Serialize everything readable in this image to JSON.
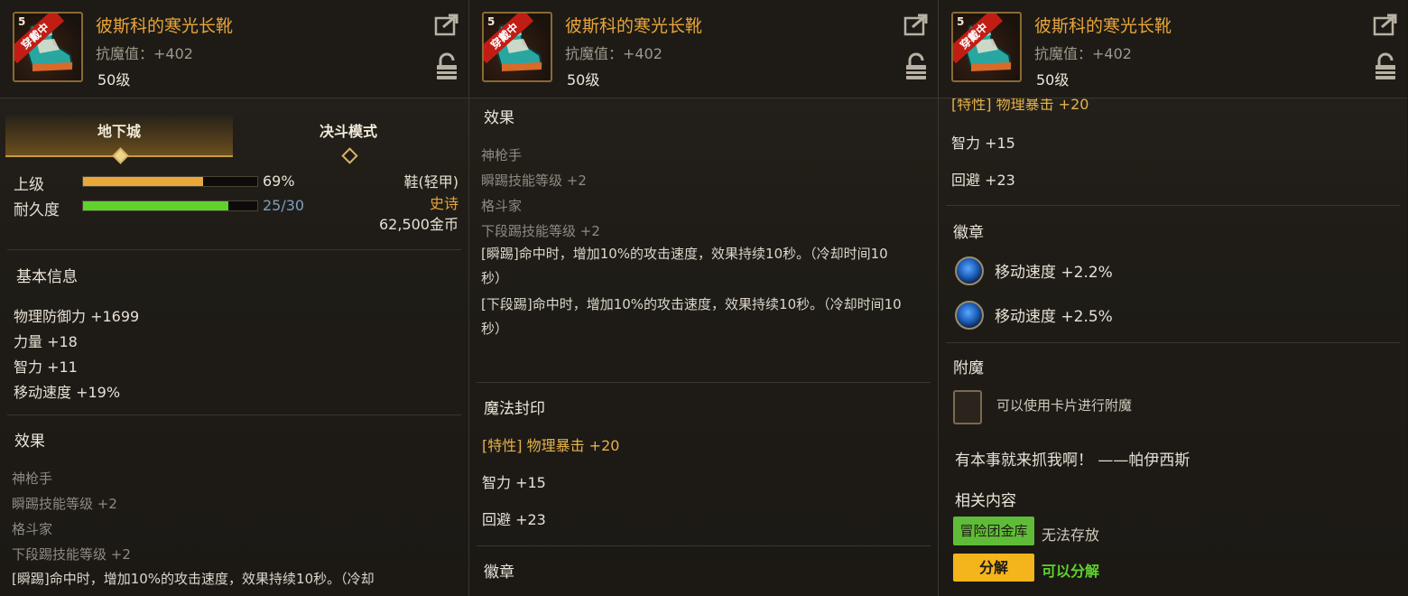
{
  "item": {
    "name": "彼斯科的寒光长靴",
    "resist": "抗魔值：+402",
    "level": "50级",
    "level_tag": "5",
    "equipped_banner": "穿戴中",
    "icon": "boot-icon"
  },
  "tabs": [
    {
      "label": "地下城",
      "active": true
    },
    {
      "label": "决斗模式",
      "active": false
    }
  ],
  "upgrade": {
    "label": "上级",
    "percent": "69%",
    "fraction": 0.69,
    "color": "#e9a93a"
  },
  "durability": {
    "label": "耐久度",
    "value": "25/30",
    "fraction": 0.8333,
    "color": "#5fd22c"
  },
  "item_type": {
    "slot": "鞋(轻甲)",
    "rarity": "史诗",
    "price": "62,500金币",
    "rarity_color": "#e7a43a"
  },
  "basic_info": {
    "title": "基本信息",
    "stats": [
      "物理防御力 +1699",
      "力量 +18",
      "智力 +11",
      "移动速度 +19%"
    ]
  },
  "effects": {
    "title": "效果",
    "lines": [
      "神枪手",
      "瞬踢技能等级 +2",
      "格斗家",
      "下段踢技能等级 +2"
    ],
    "desc1": "[瞬踢]命中时，增加10%的攻击速度，效果持续10秒。（冷却时间10秒）",
    "desc2": "[下段踢]命中时，增加10%的攻击速度，效果持续10秒。（冷却时间10秒）",
    "desc1_cut": "[瞬踢]命中时，增加10%的攻击速度，效果持续10秒。（冷却"
  },
  "magic_seal": {
    "title": "魔法封印",
    "trait": "[特性] 物理暴击 +20",
    "stats": [
      "智力 +15",
      "回避 +23"
    ]
  },
  "emblem": {
    "title": "徽章",
    "items": [
      "移动速度 +2.2%",
      "移动速度 +2.5%"
    ]
  },
  "enchant": {
    "title": "附魔",
    "text": "可以使用卡片进行附魔"
  },
  "quote": "有本事就来抓我啊！  ——帕伊西斯",
  "related": {
    "title": "相关内容",
    "storage_button": "冒险团金库",
    "storage_status": "无法存放",
    "disassemble_button": "分解",
    "disassemble_status": "可以分解",
    "disassemble_status_color": "#5fd22c"
  }
}
